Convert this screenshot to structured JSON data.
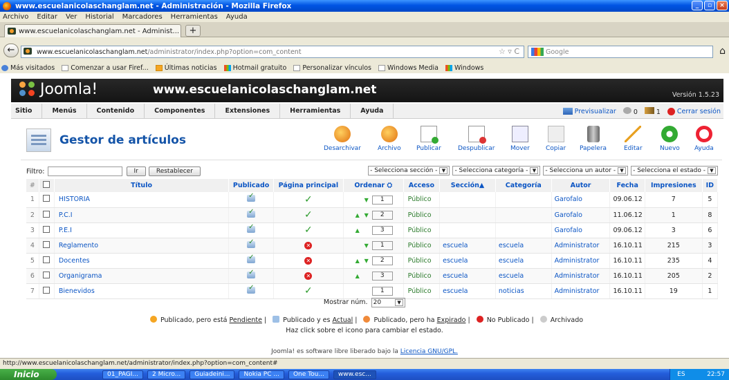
{
  "window": {
    "title": "www.escuelanicolaschanglam.net - Administración - Mozilla Firefox"
  },
  "menubar": [
    "Archivo",
    "Editar",
    "Ver",
    "Historial",
    "Marcadores",
    "Herramientas",
    "Ayuda"
  ],
  "tab": {
    "label": "www.escuelanicolaschanglam.net - Administ..."
  },
  "nav": {
    "url_domain": "www.escuelanicolaschanglam.net",
    "url_path": "/administrator/index.php?option=com_content",
    "search_placeholder": "Google"
  },
  "bookmarks": [
    "Más visitados",
    "Comenzar a usar Firef...",
    "Últimas noticias",
    "Hotmail gratuito",
    "Personalizar vínculos",
    "Windows Media",
    "Windows"
  ],
  "joomla": {
    "logo": "Joomla!",
    "site": "www.escuelanicolaschanglam.net",
    "version": "Versión 1.5.23",
    "menu": [
      "Sitio",
      "Menús",
      "Contenido",
      "Componentes",
      "Extensiones",
      "Herramientas",
      "Ayuda"
    ],
    "preview": "Previsualizar",
    "count_msgs": "0",
    "count_users": "1",
    "logout": "Cerrar sesión"
  },
  "page_title": "Gestor de artículos",
  "toolbar": [
    "Desarchivar",
    "Archivo",
    "Publicar",
    "Despublicar",
    "Mover",
    "Copiar",
    "Papelera",
    "Editar",
    "Nuevo",
    "Ayuda"
  ],
  "filters": {
    "label": "Filtro:",
    "go": "Ir",
    "reset": "Restablecer",
    "selects": [
      "- Selecciona sección -",
      "- Selecciona categoría -",
      "- Selecciona un autor -",
      "- Selecciona el estado -"
    ]
  },
  "columns": [
    "#",
    "Título",
    "Publicado",
    "Página principal",
    "Ordenar",
    "Acceso",
    "Sección",
    "Categoría",
    "Autor",
    "Fecha",
    "Impresiones",
    "ID"
  ],
  "rows": [
    {
      "n": "1",
      "title": "HISTORIA",
      "front": true,
      "arrows": "down",
      "order": "1",
      "access": "Público",
      "section": "",
      "category": "",
      "author": "Garofalo",
      "date": "09.06.12",
      "hits": "7",
      "id": "5"
    },
    {
      "n": "2",
      "title": "P.C.I",
      "front": true,
      "arrows": "both",
      "order": "2",
      "access": "Público",
      "section": "",
      "category": "",
      "author": "Garofalo",
      "date": "11.06.12",
      "hits": "1",
      "id": "8"
    },
    {
      "n": "3",
      "title": "P.E.I",
      "front": true,
      "arrows": "up",
      "order": "3",
      "access": "Público",
      "section": "",
      "category": "",
      "author": "Garofalo",
      "date": "09.06.12",
      "hits": "3",
      "id": "6"
    },
    {
      "n": "4",
      "title": "Reglamento",
      "front": false,
      "arrows": "down",
      "order": "1",
      "access": "Público",
      "section": "escuela",
      "category": "escuela",
      "author": "Administrator",
      "date": "16.10.11",
      "hits": "215",
      "id": "3"
    },
    {
      "n": "5",
      "title": "Docentes",
      "front": false,
      "arrows": "both",
      "order": "2",
      "access": "Público",
      "section": "escuela",
      "category": "escuela",
      "author": "Administrator",
      "date": "16.10.11",
      "hits": "235",
      "id": "4"
    },
    {
      "n": "6",
      "title": "Organigrama",
      "front": false,
      "arrows": "up",
      "order": "3",
      "access": "Público",
      "section": "escuela",
      "category": "escuela",
      "author": "Administrator",
      "date": "16.10.11",
      "hits": "205",
      "id": "2"
    },
    {
      "n": "7",
      "title": "Bienevidos",
      "front": true,
      "arrows": "none",
      "order": "1",
      "access": "Público",
      "section": "escuela",
      "category": "noticias",
      "author": "Administrator",
      "date": "16.10.11",
      "hits": "19",
      "id": "1"
    }
  ],
  "pager": {
    "label": "Mostrar núm.",
    "value": "20"
  },
  "legend": {
    "pending": "Publicado, pero está",
    "pending_link": "Pendiente",
    "current": "Publicado y es",
    "current_link": "Actual",
    "expired": "Publicado, pero ha",
    "expired_link": "Expirado",
    "unpublished": "No Publicado |",
    "archived": "Archivado",
    "hint": "Haz click sobre el icono para cambiar el estado."
  },
  "footer": {
    "text": "Joomla! es software libre liberado bajo la",
    "link": "Licencia GNU/GPL."
  },
  "status_url": "http://www.escuelanicolaschanglam.net/administrator/index.php?option=com_content#",
  "taskbar": {
    "start": "Inicio",
    "tasks": [
      "01_PAGI...",
      "2 Micro...",
      "Guiadeini...",
      "Nokia PC ...",
      "One Tou...",
      "www.esc..."
    ],
    "lang": "ES",
    "clock": "22:57"
  },
  "colors": {
    "link": "#0b55c4",
    "title_blue": "#1454a8",
    "header_bg": "#1c1c1c"
  }
}
